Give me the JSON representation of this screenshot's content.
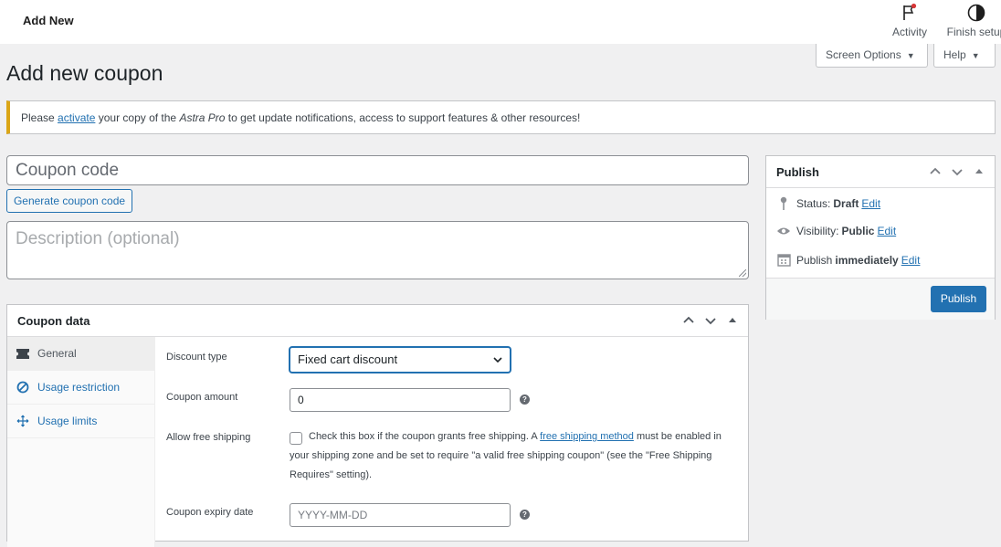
{
  "header": {
    "breadcrumb": "Add New",
    "activity_label": "Activity",
    "finish_label": "Finish setup"
  },
  "screen_options": {
    "label": "Screen Options",
    "help_label": "Help"
  },
  "page_title": "Add new coupon",
  "notice": {
    "prefix": "Please ",
    "link": "activate",
    "middle": " your copy of the ",
    "product": "Astra Pro",
    "suffix": " to get update notifications, access to support features & other resources!",
    "accent_color": "#dba617"
  },
  "coupon": {
    "code_placeholder": "Coupon code",
    "generate_label": "Generate coupon code",
    "description_placeholder": "Description (optional)"
  },
  "publish": {
    "title": "Publish",
    "status_label": "Status:",
    "status_value": "Draft",
    "visibility_label": "Visibility:",
    "visibility_value": "Public",
    "publish_label": "Publish",
    "publish_value": "immediately",
    "edit": "Edit",
    "button": "Publish",
    "button_color": "#2271b1"
  },
  "coupon_data": {
    "title": "Coupon data",
    "tabs": [
      {
        "label": "General",
        "icon": "ticket-icon"
      },
      {
        "label": "Usage restriction",
        "icon": "block-icon"
      },
      {
        "label": "Usage limits",
        "icon": "arrows-icon"
      }
    ],
    "discount_type_label": "Discount type",
    "discount_type_value": "Fixed cart discount",
    "amount_label": "Coupon amount",
    "amount_value": "0",
    "free_shipping_label": "Allow free shipping",
    "free_shipping_text_a": "Check this box if the coupon grants free shipping. A ",
    "free_shipping_link": "free shipping method",
    "free_shipping_text_b": " must be enabled in your shipping zone and be set to require \"a valid free shipping coupon\" (see the \"Free Shipping Requires\" setting).",
    "expiry_label": "Coupon expiry date",
    "expiry_placeholder": "YYYY-MM-DD"
  }
}
